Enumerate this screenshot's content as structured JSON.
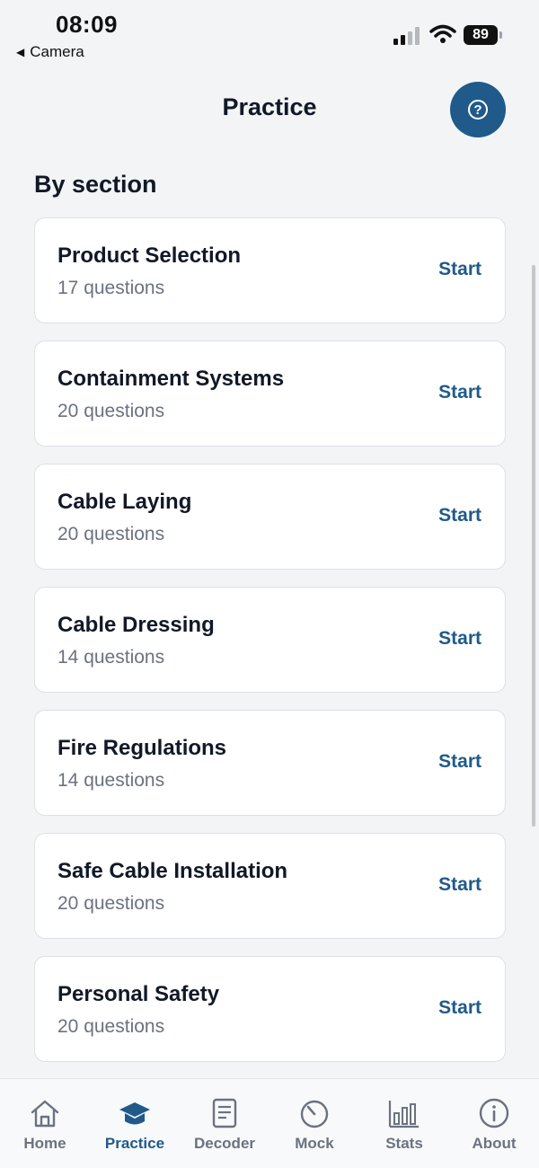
{
  "status_bar": {
    "time": "08:09",
    "back_app": "Camera",
    "battery": "89"
  },
  "header": {
    "title": "Practice",
    "help_icon": "question-circle-icon"
  },
  "section_heading": "By section",
  "cards": [
    {
      "title": "Product Selection",
      "count": "17 questions",
      "action": "Start"
    },
    {
      "title": "Containment Systems",
      "count": "20 questions",
      "action": "Start"
    },
    {
      "title": "Cable Laying",
      "count": "20 questions",
      "action": "Start"
    },
    {
      "title": "Cable Dressing",
      "count": "14 questions",
      "action": "Start"
    },
    {
      "title": "Fire Regulations",
      "count": "14 questions",
      "action": "Start"
    },
    {
      "title": "Safe Cable Installation",
      "count": "20 questions",
      "action": "Start"
    },
    {
      "title": "Personal Safety",
      "count": "20 questions",
      "action": "Start"
    }
  ],
  "tabs": [
    {
      "label": "Home",
      "icon": "home-icon"
    },
    {
      "label": "Practice",
      "icon": "graduation-cap-icon",
      "active": true
    },
    {
      "label": "Decoder",
      "icon": "document-icon"
    },
    {
      "label": "Mock",
      "icon": "timer-icon"
    },
    {
      "label": "Stats",
      "icon": "bar-chart-icon"
    },
    {
      "label": "About",
      "icon": "info-icon"
    }
  ],
  "colors": {
    "accent": "#1f5a8a",
    "background": "#f2f4f6",
    "muted_text": "#6b7280"
  }
}
